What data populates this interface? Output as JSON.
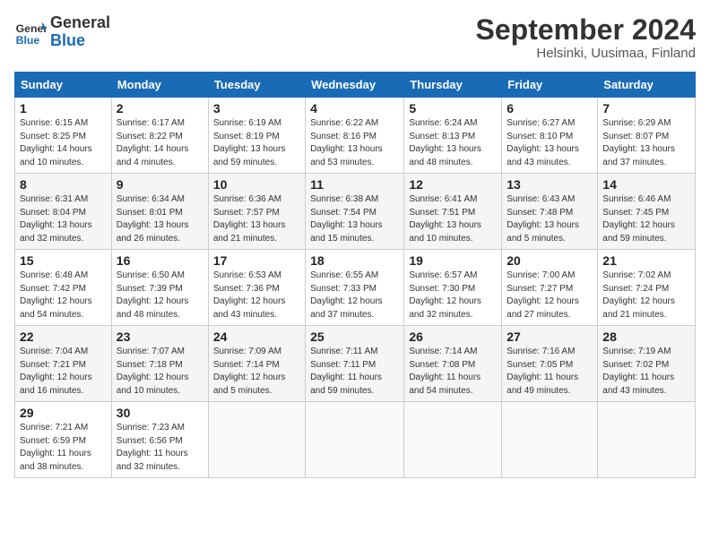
{
  "header": {
    "logo_text_general": "General",
    "logo_text_blue": "Blue",
    "month": "September 2024",
    "location": "Helsinki, Uusimaa, Finland"
  },
  "weekdays": [
    "Sunday",
    "Monday",
    "Tuesday",
    "Wednesday",
    "Thursday",
    "Friday",
    "Saturday"
  ],
  "weeks": [
    [
      {
        "day": "1",
        "sunrise": "6:15 AM",
        "sunset": "8:25 PM",
        "daylight": "14 hours and 10 minutes."
      },
      {
        "day": "2",
        "sunrise": "6:17 AM",
        "sunset": "8:22 PM",
        "daylight": "14 hours and 4 minutes."
      },
      {
        "day": "3",
        "sunrise": "6:19 AM",
        "sunset": "8:19 PM",
        "daylight": "13 hours and 59 minutes."
      },
      {
        "day": "4",
        "sunrise": "6:22 AM",
        "sunset": "8:16 PM",
        "daylight": "13 hours and 53 minutes."
      },
      {
        "day": "5",
        "sunrise": "6:24 AM",
        "sunset": "8:13 PM",
        "daylight": "13 hours and 48 minutes."
      },
      {
        "day": "6",
        "sunrise": "6:27 AM",
        "sunset": "8:10 PM",
        "daylight": "13 hours and 43 minutes."
      },
      {
        "day": "7",
        "sunrise": "6:29 AM",
        "sunset": "8:07 PM",
        "daylight": "13 hours and 37 minutes."
      }
    ],
    [
      {
        "day": "8",
        "sunrise": "6:31 AM",
        "sunset": "8:04 PM",
        "daylight": "13 hours and 32 minutes."
      },
      {
        "day": "9",
        "sunrise": "6:34 AM",
        "sunset": "8:01 PM",
        "daylight": "13 hours and 26 minutes."
      },
      {
        "day": "10",
        "sunrise": "6:36 AM",
        "sunset": "7:57 PM",
        "daylight": "13 hours and 21 minutes."
      },
      {
        "day": "11",
        "sunrise": "6:38 AM",
        "sunset": "7:54 PM",
        "daylight": "13 hours and 15 minutes."
      },
      {
        "day": "12",
        "sunrise": "6:41 AM",
        "sunset": "7:51 PM",
        "daylight": "13 hours and 10 minutes."
      },
      {
        "day": "13",
        "sunrise": "6:43 AM",
        "sunset": "7:48 PM",
        "daylight": "13 hours and 5 minutes."
      },
      {
        "day": "14",
        "sunrise": "6:46 AM",
        "sunset": "7:45 PM",
        "daylight": "12 hours and 59 minutes."
      }
    ],
    [
      {
        "day": "15",
        "sunrise": "6:48 AM",
        "sunset": "7:42 PM",
        "daylight": "12 hours and 54 minutes."
      },
      {
        "day": "16",
        "sunrise": "6:50 AM",
        "sunset": "7:39 PM",
        "daylight": "12 hours and 48 minutes."
      },
      {
        "day": "17",
        "sunrise": "6:53 AM",
        "sunset": "7:36 PM",
        "daylight": "12 hours and 43 minutes."
      },
      {
        "day": "18",
        "sunrise": "6:55 AM",
        "sunset": "7:33 PM",
        "daylight": "12 hours and 37 minutes."
      },
      {
        "day": "19",
        "sunrise": "6:57 AM",
        "sunset": "7:30 PM",
        "daylight": "12 hours and 32 minutes."
      },
      {
        "day": "20",
        "sunrise": "7:00 AM",
        "sunset": "7:27 PM",
        "daylight": "12 hours and 27 minutes."
      },
      {
        "day": "21",
        "sunrise": "7:02 AM",
        "sunset": "7:24 PM",
        "daylight": "12 hours and 21 minutes."
      }
    ],
    [
      {
        "day": "22",
        "sunrise": "7:04 AM",
        "sunset": "7:21 PM",
        "daylight": "12 hours and 16 minutes."
      },
      {
        "day": "23",
        "sunrise": "7:07 AM",
        "sunset": "7:18 PM",
        "daylight": "12 hours and 10 minutes."
      },
      {
        "day": "24",
        "sunrise": "7:09 AM",
        "sunset": "7:14 PM",
        "daylight": "12 hours and 5 minutes."
      },
      {
        "day": "25",
        "sunrise": "7:11 AM",
        "sunset": "7:11 PM",
        "daylight": "11 hours and 59 minutes."
      },
      {
        "day": "26",
        "sunrise": "7:14 AM",
        "sunset": "7:08 PM",
        "daylight": "11 hours and 54 minutes."
      },
      {
        "day": "27",
        "sunrise": "7:16 AM",
        "sunset": "7:05 PM",
        "daylight": "11 hours and 49 minutes."
      },
      {
        "day": "28",
        "sunrise": "7:19 AM",
        "sunset": "7:02 PM",
        "daylight": "11 hours and 43 minutes."
      }
    ],
    [
      {
        "day": "29",
        "sunrise": "7:21 AM",
        "sunset": "6:59 PM",
        "daylight": "11 hours and 38 minutes."
      },
      {
        "day": "30",
        "sunrise": "7:23 AM",
        "sunset": "6:56 PM",
        "daylight": "11 hours and 32 minutes."
      },
      null,
      null,
      null,
      null,
      null
    ]
  ]
}
